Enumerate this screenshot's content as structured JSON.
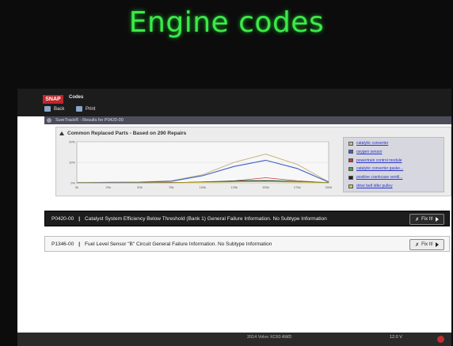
{
  "caption": "Engine codes",
  "app": {
    "logo_text": "SNAP",
    "title": "Codes"
  },
  "toolbar": {
    "back_label": "Back",
    "print_label": "Print"
  },
  "results_bar": "SureTrack® - Results for P0420-00",
  "panel": {
    "title": "Common Replaced Parts - Based on 290 Repairs"
  },
  "chart_data": {
    "type": "line",
    "x": [
      "0k",
      "20k",
      "50k",
      "75k",
      "100k",
      "125k",
      "150k",
      "175k",
      "200k"
    ],
    "ylabel": "",
    "yticks": [
      "20%",
      "10%",
      "0%"
    ],
    "ylim": [
      0,
      20
    ],
    "grid": true,
    "legend": "right",
    "series": [
      {
        "name": "catalytic converter",
        "color": "#c9b98a",
        "values": [
          0.2,
          0.3,
          0.4,
          1.0,
          4.0,
          10.0,
          14.0,
          9.0,
          0.5
        ]
      },
      {
        "name": "oxygen sensor",
        "color": "#3f5fc8",
        "values": [
          0.1,
          0.2,
          0.3,
          0.8,
          3.5,
          8.0,
          11.0,
          7.0,
          0.4
        ]
      },
      {
        "name": "powertrain control module",
        "color": "#c03a3a",
        "values": [
          0,
          0,
          0.1,
          0.2,
          0.3,
          1.0,
          2.5,
          1.0,
          0.1
        ]
      },
      {
        "name": "catalytic converter gaske...",
        "color": "#4aa04a",
        "values": [
          0,
          0,
          0.1,
          0.1,
          0.5,
          1.0,
          1.2,
          0.8,
          0.1
        ]
      },
      {
        "name": "positive crankcase ventil...",
        "color": "#222222",
        "values": [
          0,
          0,
          0,
          0.1,
          0.4,
          0.8,
          1.0,
          0.5,
          0.1
        ]
      },
      {
        "name": "drive belt idler pulley",
        "color": "#d8c23a",
        "values": [
          0,
          0,
          0,
          0,
          0.3,
          0.5,
          0.6,
          0.4,
          0
        ]
      }
    ]
  },
  "codes": [
    {
      "code": "P0420-00",
      "sep": "|",
      "description": "Catalyst System Efficiency Below Threshold (Bank 1) General Failure Information. No Subtype Information",
      "fix_label": "Fix It!"
    },
    {
      "code": "P1346-00",
      "sep": "|",
      "description": "Fuel Level Sensor \"B\" Circuit General Failure Information. No Subtype Information",
      "fix_label": "Fix It!"
    }
  ],
  "taskbar": {
    "vehicle": "2014 Volvo XC60 AWD",
    "voltage": "12.0 V"
  }
}
